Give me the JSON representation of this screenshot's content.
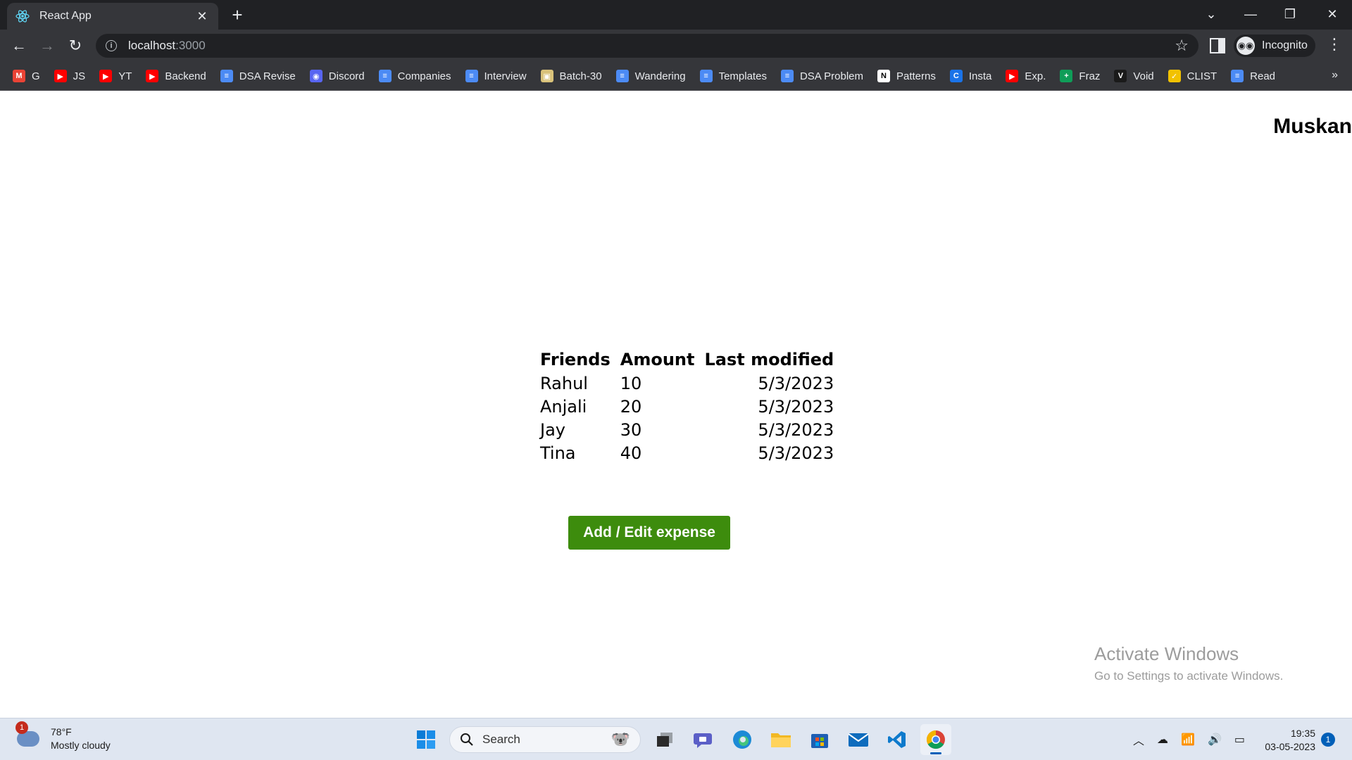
{
  "browser": {
    "tab_title": "React App",
    "url_host": "localhost",
    "url_port": ":3000",
    "incognito_label": "Incognito",
    "bookmarks": [
      {
        "label": "G",
        "icon": "gmail-icon",
        "color": "#ea4335"
      },
      {
        "label": "JS",
        "icon": "youtube-icon",
        "color": "#ff0000"
      },
      {
        "label": "YT",
        "icon": "youtube-icon",
        "color": "#ff0000"
      },
      {
        "label": "Backend",
        "icon": "youtube-icon",
        "color": "#ff0000"
      },
      {
        "label": "DSA Revise",
        "icon": "docs-icon",
        "color": "#4c8bf5"
      },
      {
        "label": "Discord",
        "icon": "discord-icon",
        "color": "#5865f2"
      },
      {
        "label": "Companies",
        "icon": "docs-icon",
        "color": "#4c8bf5"
      },
      {
        "label": "Interview",
        "icon": "docs-icon",
        "color": "#4c8bf5"
      },
      {
        "label": "Batch-30",
        "icon": "image-icon",
        "color": "#d9c27a"
      },
      {
        "label": "Wandering",
        "icon": "docs-icon",
        "color": "#4c8bf5"
      },
      {
        "label": "Templates",
        "icon": "docs-icon",
        "color": "#4c8bf5"
      },
      {
        "label": "DSA Problem",
        "icon": "docs-icon",
        "color": "#4c8bf5"
      },
      {
        "label": "Patterns",
        "icon": "notion-icon",
        "color": "#ffffff"
      },
      {
        "label": "Insta",
        "icon": "circle-c-icon",
        "color": "#1a73e8"
      },
      {
        "label": "Exp.",
        "icon": "youtube-icon",
        "color": "#ff0000"
      },
      {
        "label": "Fraz",
        "icon": "sheets-icon",
        "color": "#0f9d58"
      },
      {
        "label": "Void",
        "icon": "void-icon",
        "color": "#1a1a1a"
      },
      {
        "label": "CLIST",
        "icon": "clist-icon",
        "color": "#f2c200"
      },
      {
        "label": "Read",
        "icon": "docs-icon",
        "color": "#4c8bf5"
      }
    ],
    "bookmarks_more": "»"
  },
  "page": {
    "username": "Muskan",
    "table": {
      "headers": [
        "Friends",
        "Amount",
        "Last modified"
      ],
      "rows": [
        [
          "Rahul",
          "10",
          "5/3/2023"
        ],
        [
          "Anjali",
          "20",
          "5/3/2023"
        ],
        [
          "Jay",
          "30",
          "5/3/2023"
        ],
        [
          "Tina",
          "40",
          "5/3/2023"
        ]
      ]
    },
    "button_label": "Add / Edit expense",
    "button_color": "#3d8c0d",
    "watermark_title": "Activate Windows",
    "watermark_sub": "Go to Settings to activate Windows."
  },
  "taskbar": {
    "weather_badge": "1",
    "temperature": "78°F",
    "weather_desc": "Mostly cloudy",
    "search_label": "Search",
    "time": "19:35",
    "date": "03-05-2023",
    "notification_count": "1"
  }
}
